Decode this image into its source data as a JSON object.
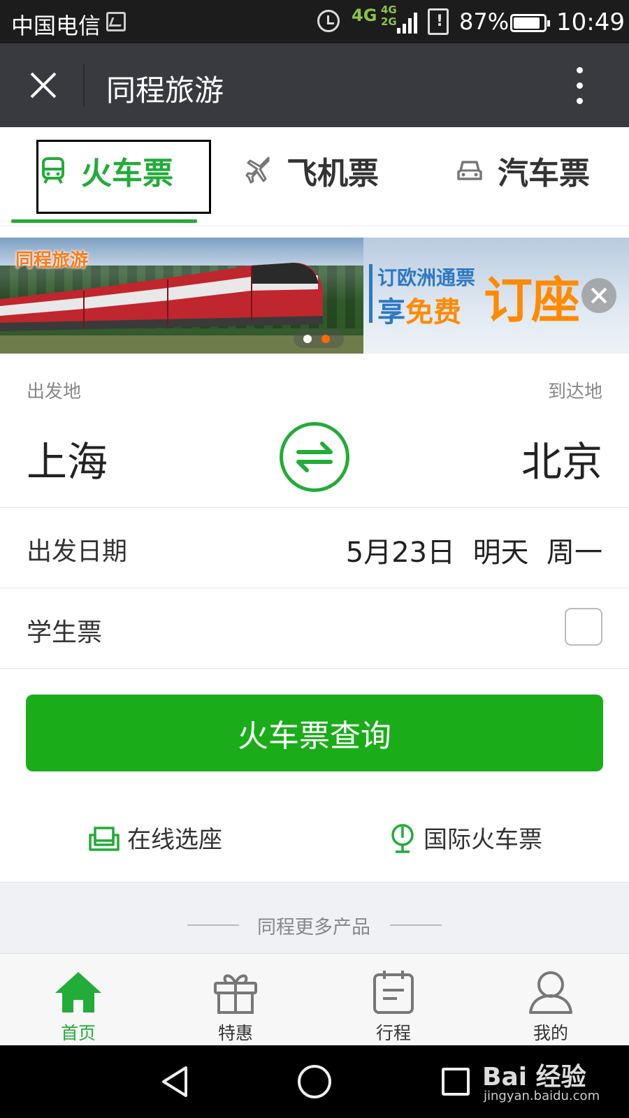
{
  "status_bar": {
    "carrier": "中国电信",
    "network_primary": "4G",
    "network_secondary": [
      "4G",
      "2G"
    ],
    "battery_percent": "87%",
    "battery_level": 0.87,
    "time": "10:49"
  },
  "titlebar": {
    "title": "同程旅游"
  },
  "tabs": [
    {
      "label": "火车票",
      "icon": "train-icon",
      "active": true
    },
    {
      "label": "飞机票",
      "icon": "airplane-icon",
      "active": false
    },
    {
      "label": "汽车票",
      "icon": "bus-icon",
      "active": false
    }
  ],
  "banner": {
    "brand": "同程旅游",
    "line1": "订欧洲通票",
    "line2_prefix": "享",
    "line2_highlight": "免费",
    "line3": "订座",
    "slide_count": 2,
    "active_slide": 2
  },
  "form": {
    "from_label": "出发地",
    "from_city": "上海",
    "to_label": "到达地",
    "to_city": "北京",
    "date_label": "出发日期",
    "date_value": "5月23日",
    "date_relative": "明天",
    "date_weekday": "周一",
    "student_label": "学生票",
    "student_checked": false,
    "search_button": "火车票查询"
  },
  "quick_links": {
    "seat": "在线选座",
    "international": "国际火车票"
  },
  "more_section": {
    "title": "同程更多产品"
  },
  "bottom_nav": [
    {
      "label": "首页",
      "icon": "home-icon",
      "active": true
    },
    {
      "label": "特惠",
      "icon": "gift-icon",
      "active": false
    },
    {
      "label": "行程",
      "icon": "itinerary-icon",
      "active": false
    },
    {
      "label": "我的",
      "icon": "profile-icon",
      "active": false
    }
  ],
  "watermark": {
    "brand": "Bai 经验",
    "url": "jingyan.baidu.com"
  },
  "colors": {
    "accent": "#22ac38",
    "button": "#1aad19",
    "titlebar": "#393a3f"
  }
}
